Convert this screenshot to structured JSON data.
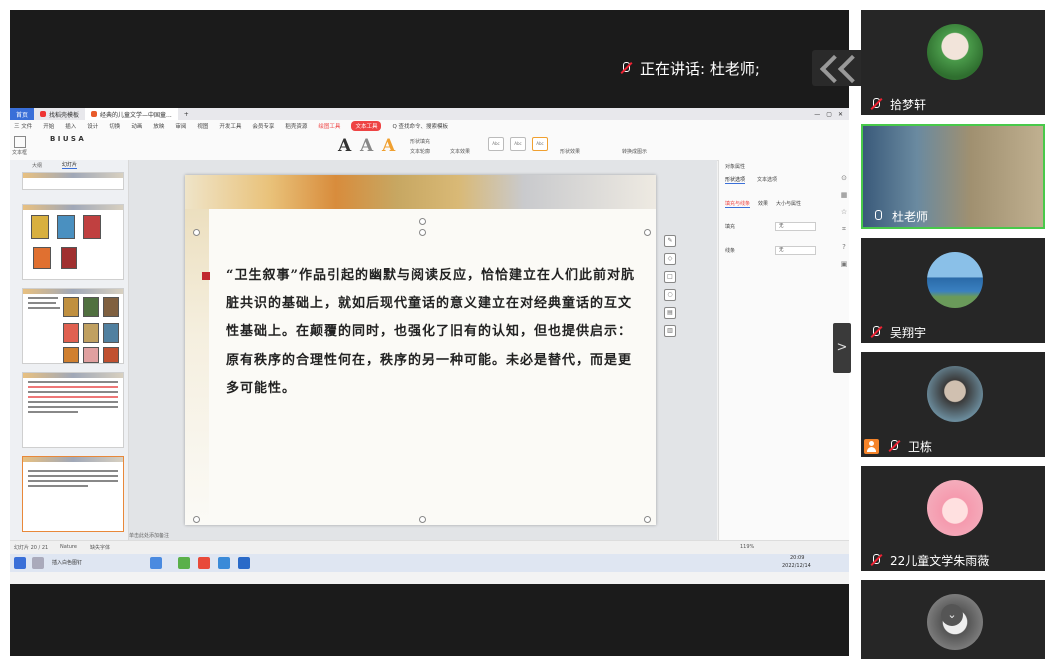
{
  "meeting": {
    "speaking_label": "正在讲话: 杜老师;"
  },
  "wps": {
    "tabs": [
      "首页",
      "找稻壳模板",
      "经典的儿童文学—中国童...",
      "+"
    ],
    "menus": [
      "三 文件",
      "开始",
      "插入",
      "设计",
      "切换",
      "动画",
      "放映",
      "审阅",
      "视图",
      "开发工具",
      "会员专享",
      "稻壳资源",
      "绘图工具",
      "文本工具",
      "Q 查找命令、搜索模板"
    ],
    "ribbon_labels": [
      "文本框",
      "形状填充",
      "文本轮廓",
      "文本效果",
      "形状效果",
      "转换成图示"
    ],
    "panel_tabs": [
      "大纲",
      "幻灯片"
    ],
    "thumb_numbers": [
      "17",
      "18",
      "19",
      "20"
    ],
    "slide_text": "“卫生叙事”作品引起的幽默与阅读反应，恰恰建立在人们此前对肮脏共识的基础上，就如后现代童话的意义建立在对经典童话的互文性基础上。在颠覆的同时，也强化了旧有的认知，但也提供启示：原有秩序的合理性何在，秩序的另一种可能。未必是替代，而是更多可能性。",
    "props": {
      "title": "对象属性",
      "tabs": [
        "形状选项",
        "文本选项"
      ],
      "subtabs": [
        "填充与线条",
        "效果",
        "大小与属性"
      ],
      "fill_label": "填充",
      "fill_value": "无",
      "line_label": "线条",
      "line_value": "无"
    },
    "notes_placeholder": "单击此处添加备注",
    "status": {
      "slide_count": "幻灯片 20 / 21",
      "theme": "Nature",
      "font_missing": "缺失字体",
      "zoom": "119%"
    },
    "taskbar": {
      "app1": "插入白色图钉",
      "clock_time": "20:09",
      "clock_date": "2022/12/14"
    }
  },
  "participants": [
    {
      "name": "拾梦轩",
      "muted": true
    },
    {
      "name": "杜老师",
      "muted": false,
      "active": true
    },
    {
      "name": "吴翔宇",
      "muted": true
    },
    {
      "name": "卫栋",
      "muted": true,
      "host": true
    },
    {
      "name": "22儿童文学朱雨薇",
      "muted": true
    },
    {
      "name": "",
      "muted": true
    }
  ],
  "colors": {
    "active_border": "#48c94a",
    "bullet": "#c1272d",
    "host": "#f5842a"
  }
}
